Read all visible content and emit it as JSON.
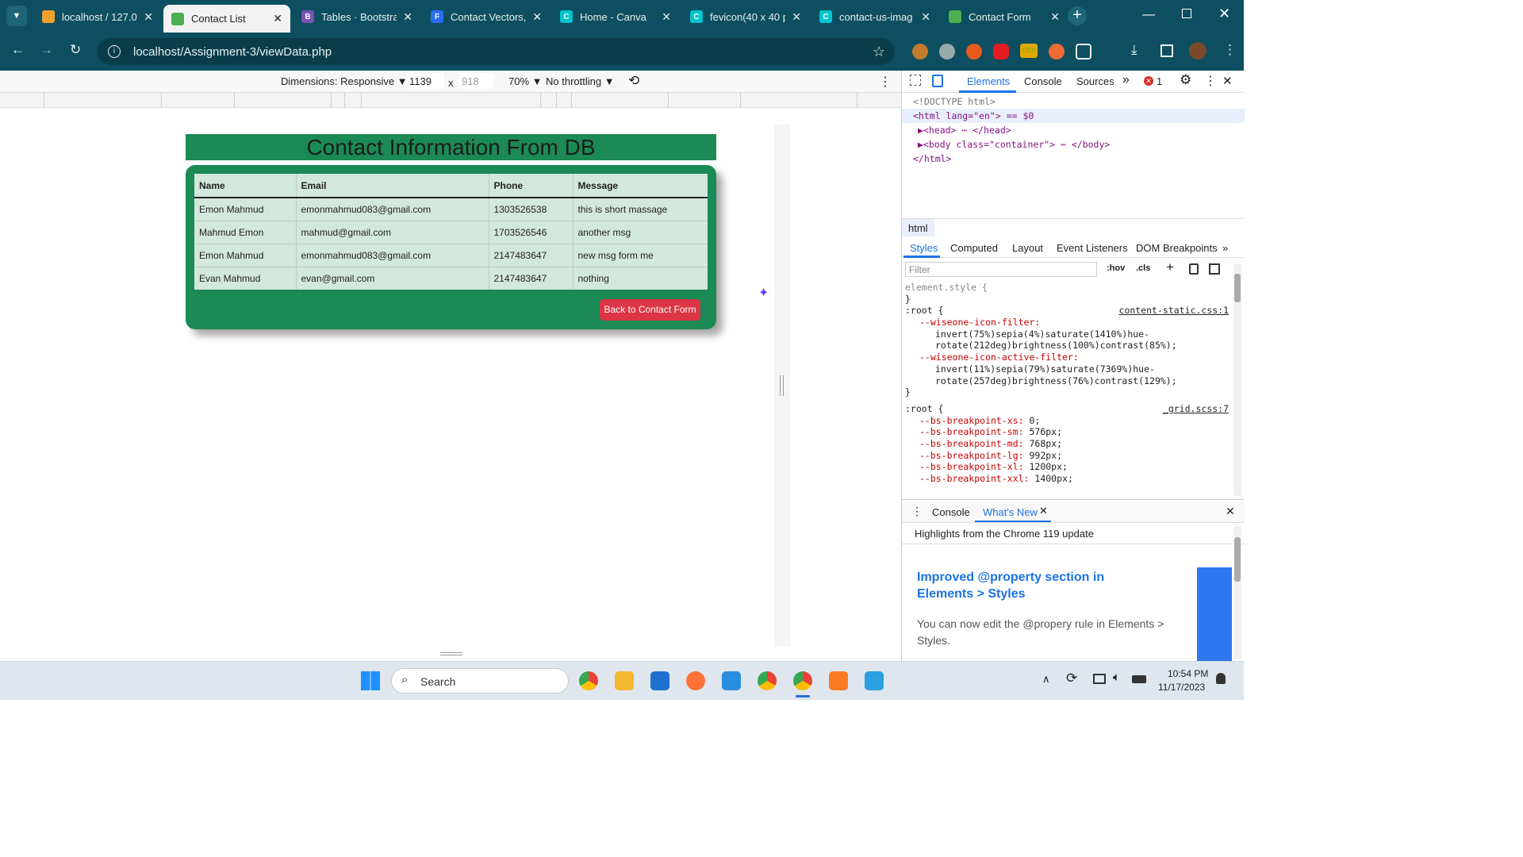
{
  "tabs": [
    {
      "title": "localhost / 127.0.",
      "icon": "phpmyadmin-icon",
      "color": "#f0a030"
    },
    {
      "title": "Contact List",
      "icon": "contact-list-icon",
      "color": "#4caf50",
      "active": true
    },
    {
      "title": "Tables · Bootstrap",
      "icon": "bootstrap-icon",
      "color": "#7952b3",
      "letter": "B"
    },
    {
      "title": "Contact Vectors,",
      "icon": "freepik-icon",
      "color": "#2a6df4",
      "letter": "F"
    },
    {
      "title": "Home - Canva",
      "icon": "canva-icon",
      "color": "#00c4cc",
      "letter": "C"
    },
    {
      "title": "fevicon(40 x 40 p",
      "icon": "canva-icon",
      "color": "#00c4cc",
      "letter": "C"
    },
    {
      "title": "contact-us-imag",
      "icon": "canva-icon",
      "color": "#00c4cc",
      "letter": "C"
    },
    {
      "title": "Contact Form",
      "icon": "contact-form-icon",
      "color": "#4caf50"
    }
  ],
  "address": "localhost/Assignment-3/viewData.php",
  "device": {
    "dimensions": "Dimensions: Responsive ▼",
    "width": "1139",
    "x": "x",
    "height": "918",
    "zoom": "70% ▼",
    "throttle": "No throttling ▼"
  },
  "page": {
    "heading": "Contact Information From DB",
    "columns": [
      "Name",
      "Email",
      "Phone",
      "Message"
    ],
    "rows": [
      [
        "Emon Mahmud",
        "emonmahmud083@gmail.com",
        "1303526538",
        "this is short massage"
      ],
      [
        "Mahmud Emon",
        "mahmud@gmail.com",
        "1703526546",
        "another msg"
      ],
      [
        "Emon Mahmud",
        "emonmahmud083@gmail.com",
        "2147483647",
        "new msg form me"
      ],
      [
        "Evan Mahmud",
        "evan@gmail.com",
        "2147483647",
        "nothing"
      ]
    ],
    "back_button": "Back to Contact Form"
  },
  "devtools": {
    "tabs": [
      "Elements",
      "Console",
      "Sources",
      "»"
    ],
    "errors": "1",
    "dom": [
      "<!DOCTYPE html>",
      "<html lang=\"en\"> == $0",
      "▶<head> ⋯ </head>",
      "▶<body class=\"container\"> ⋯ </body>",
      "</html>"
    ],
    "breadcrumb": "html",
    "style_tabs": [
      "Styles",
      "Computed",
      "Layout",
      "Event Listeners",
      "DOM Breakpoints",
      "»"
    ],
    "filter_placeholder": "Filter",
    "hov": ":hov",
    "cls": ".cls",
    "css": [
      {
        "sel": "element.style {",
        "src": ""
      },
      {
        "sel": "}",
        "src": ""
      },
      {
        "sel": ":root {",
        "src": "content-static.css:1"
      },
      {
        "prop": "--wiseone-icon-filter:",
        "src": ""
      },
      {
        "val": "invert(75%)sepia(4%)saturate(1410%)hue-",
        "src": ""
      },
      {
        "val": "rotate(212deg)brightness(100%)contrast(85%);",
        "src": ""
      },
      {
        "prop": "--wiseone-icon-active-filter:",
        "src": ""
      },
      {
        "val": "invert(11%)sepia(79%)saturate(7369%)hue-",
        "src": ""
      },
      {
        "val": "rotate(257deg)brightness(76%)contrast(129%);",
        "src": ""
      },
      {
        "sel": "}",
        "src": ""
      },
      {
        "sel": ":root {",
        "src": "_grid.scss:7"
      },
      {
        "prop": "--bs-breakpoint-xs:",
        "val": " 0;"
      },
      {
        "prop": "--bs-breakpoint-sm:",
        "val": " 576px;"
      },
      {
        "prop": "--bs-breakpoint-md:",
        "val": " 768px;"
      },
      {
        "prop": "--bs-breakpoint-lg:",
        "val": " 992px;"
      },
      {
        "prop": "--bs-breakpoint-xl:",
        "val": " 1200px;"
      },
      {
        "prop": "--bs-breakpoint-xxl:",
        "val": " 1400px;"
      }
    ],
    "drawer_tabs": [
      "Console",
      "What's New"
    ],
    "highlights": "Highlights from the Chrome 119 update",
    "whatsnew_title": "Improved @property section in Elements > Styles",
    "whatsnew_body": "You can now edit the @propery rule in Elements > Styles."
  },
  "taskbar": {
    "search": "Search",
    "time": "10:54 PM",
    "date": "11/17/2023"
  }
}
